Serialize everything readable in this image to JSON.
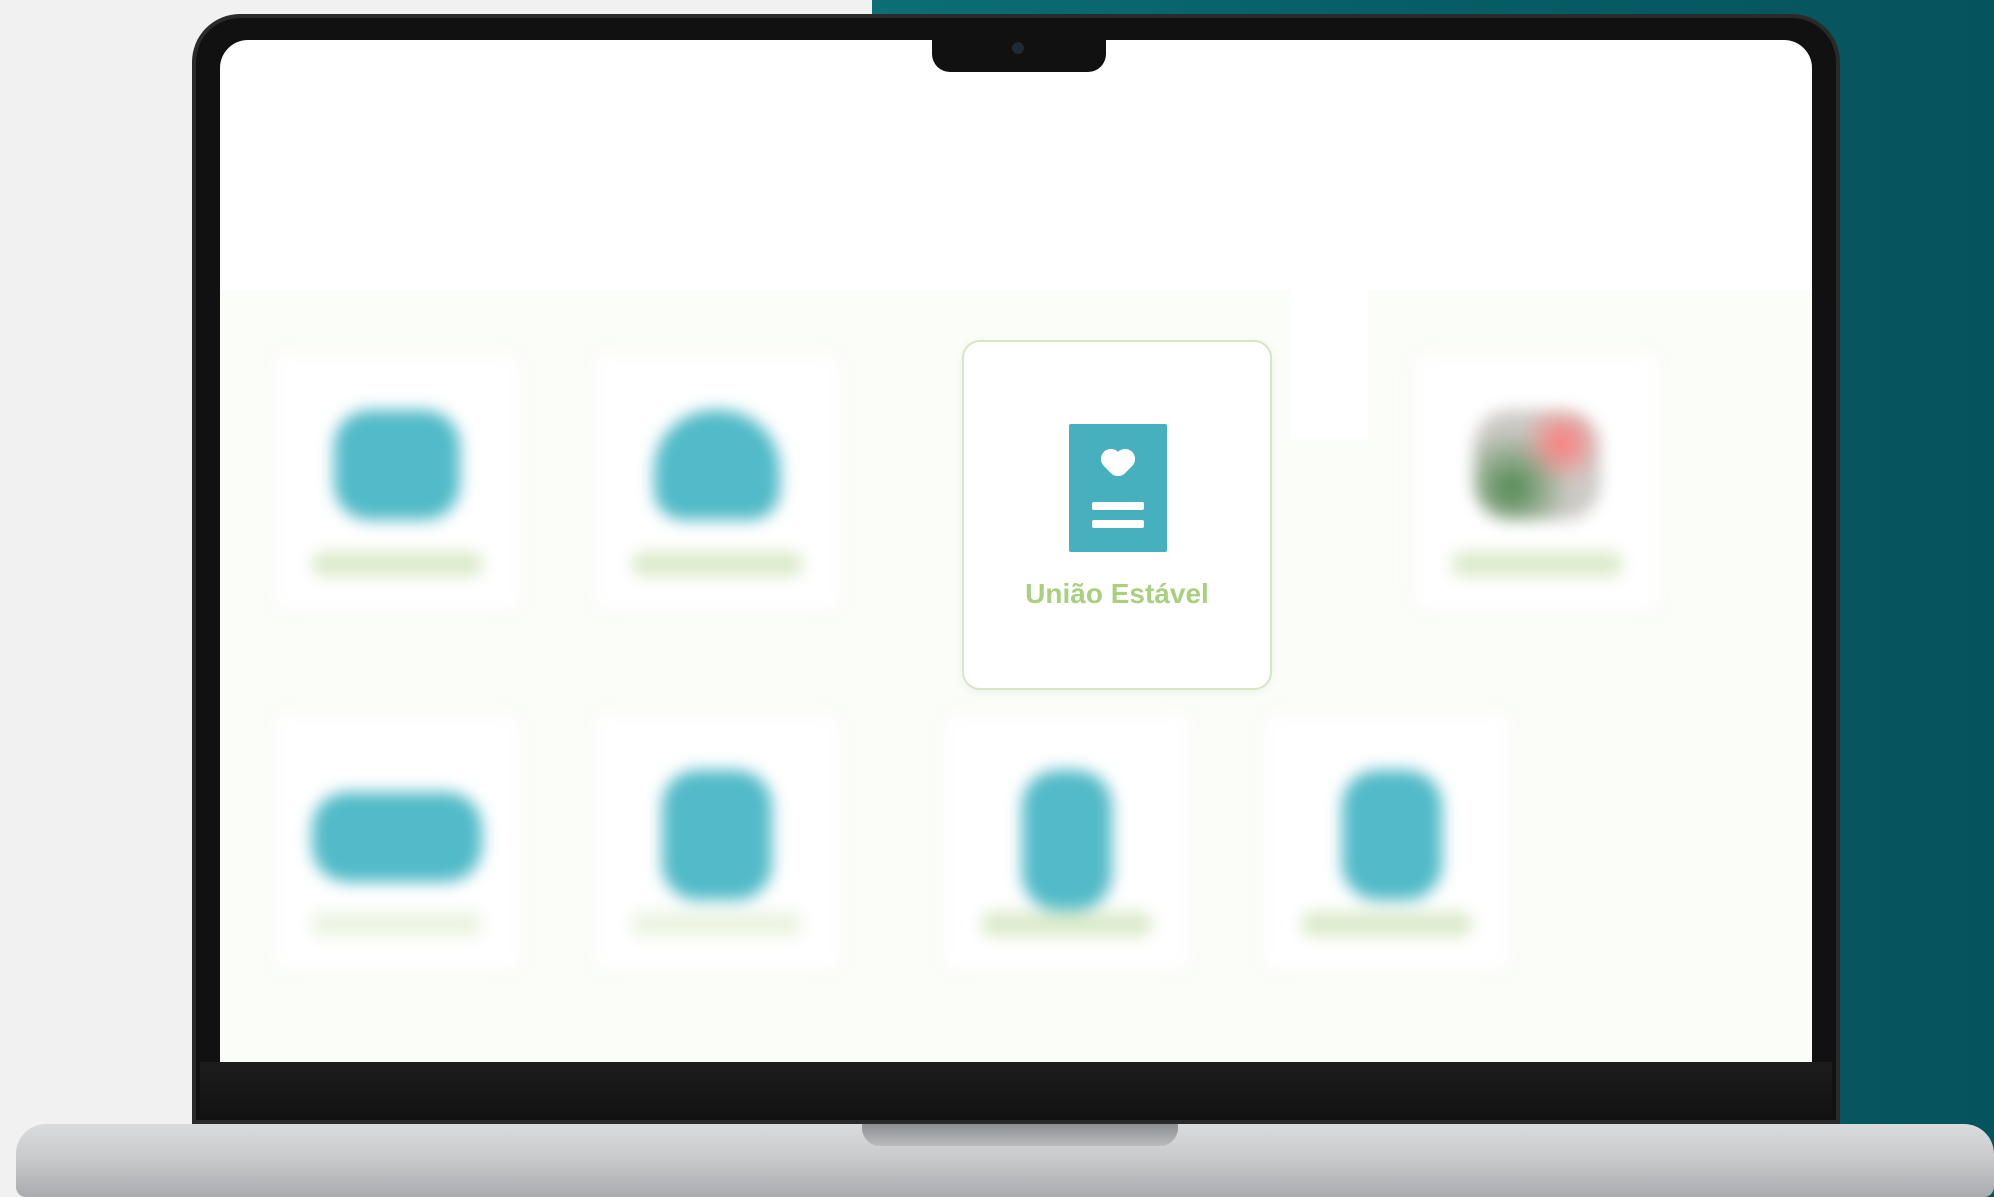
{
  "scene": {
    "background_left_color": "#f1f1f1",
    "background_right_color": "#075e66",
    "laptop_body_color": "#111111",
    "laptop_base_color": "#c9cbcd"
  },
  "screen": {
    "focused_card": {
      "label": "União Estável",
      "icon": "document-heart-icon",
      "icon_color": "#46b0bf",
      "label_color": "#a9d07e"
    },
    "blurred_cards_count": 7
  }
}
